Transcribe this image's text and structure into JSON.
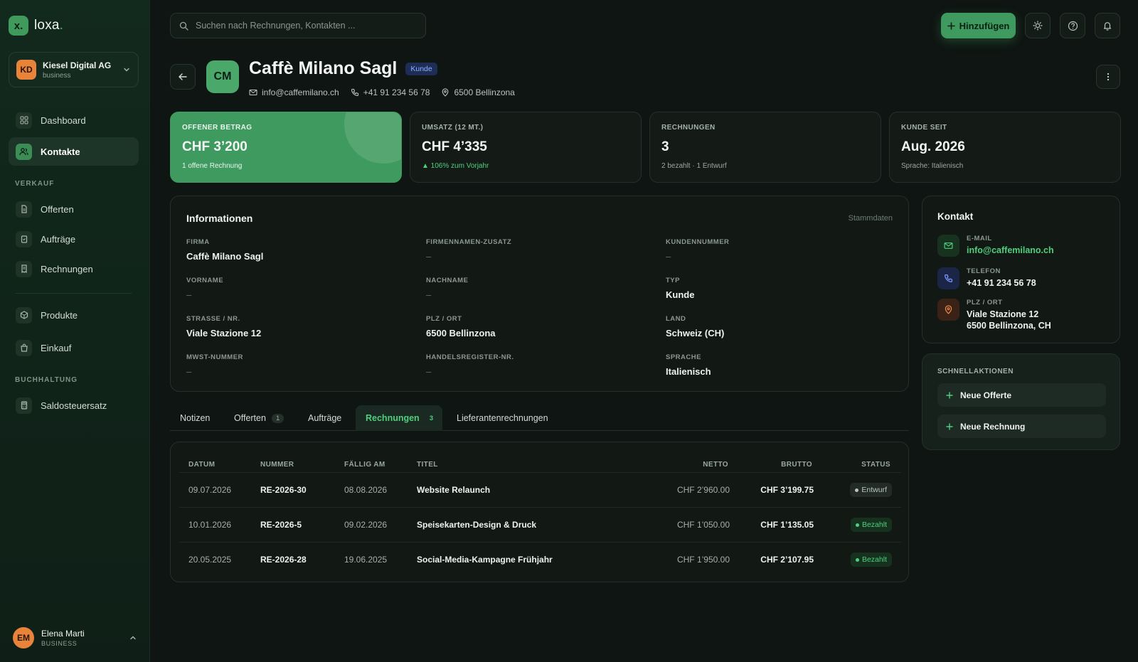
{
  "brand": {
    "logo": "x.",
    "name": "loxa",
    "dot": "."
  },
  "org": {
    "initials": "KD",
    "name": "Kiesel Digital AG",
    "plan": "business"
  },
  "nav": {
    "dashboard": "Dashboard",
    "kontakte": "Kontakte",
    "section_verkauf": "VERKAUF",
    "offerten": "Offerten",
    "auftraege": "Aufträge",
    "rechnungen": "Rechnungen",
    "produkte": "Produkte",
    "einkauf": "Einkauf",
    "section_buchhaltung": "BUCHHALTUNG",
    "saldo": "Saldosteuersatz"
  },
  "user": {
    "initials": "EM",
    "name": "Elena Marti",
    "plan": "BUSINESS"
  },
  "topbar": {
    "search_placeholder": "Suchen nach Rechnungen, Kontakten ...",
    "add_label": "Hinzufügen"
  },
  "contact": {
    "initials": "CM",
    "name": "Caffè Milano Sagl",
    "badge": "Kunde",
    "email": "info@caffemilano.ch",
    "phone": "+41 91 234 56 78",
    "location": "6500 Bellinzona"
  },
  "stats": [
    {
      "label": "OFFENER BETRAG",
      "value": "CHF 3’200",
      "sub": "1 offene Rechnung"
    },
    {
      "label": "UMSATZ (12 MT.)",
      "value": "CHF 4’335",
      "sub": "▲ 106% zum Vorjahr"
    },
    {
      "label": "RECHNUNGEN",
      "value": "3",
      "sub": "2 bezahlt · 1 Entwurf"
    },
    {
      "label": "KUNDE SEIT",
      "value": "Aug. 2026",
      "sub": "Sprache: Italienisch"
    }
  ],
  "info": {
    "title": "Informationen",
    "right_label": "Stammdaten",
    "fields": [
      {
        "label": "FIRMA",
        "value": "Caffè Milano Sagl"
      },
      {
        "label": "FIRMENNAMEN-ZUSATZ",
        "value": "–"
      },
      {
        "label": "KUNDENNUMMER",
        "value": "–"
      },
      {
        "label": "VORNAME",
        "value": "–"
      },
      {
        "label": "NACHNAME",
        "value": "–"
      },
      {
        "label": "TYP",
        "value": "Kunde"
      },
      {
        "label": "STRASSE / NR.",
        "value": "Viale Stazione 12"
      },
      {
        "label": "PLZ / ORT",
        "value": "6500 Bellinzona"
      },
      {
        "label": "LAND",
        "value": "Schweiz (CH)"
      },
      {
        "label": "MWST-NUMMER",
        "value": "–"
      },
      {
        "label": "HANDELSREGISTER-NR.",
        "value": "–"
      },
      {
        "label": "SPRACHE",
        "value": "Italienisch"
      }
    ]
  },
  "kontakt": {
    "title": "Kontakt",
    "email_label": "E-MAIL",
    "email": "info@caffemilano.ch",
    "phone_label": "TELEFON",
    "phone": "+41 91 234 56 78",
    "addr_label": "PLZ / ORT",
    "addr_line1": "Viale Stazione 12",
    "addr_line2": "6500 Bellinzona, CH"
  },
  "quick": {
    "title": "SCHNELLAKTIONEN",
    "new_offer": "Neue Offerte",
    "new_invoice": "Neue Rechnung"
  },
  "tabs": [
    {
      "label": "Notizen",
      "count": ""
    },
    {
      "label": "Offerten",
      "count": "1"
    },
    {
      "label": "Aufträge",
      "count": ""
    },
    {
      "label": "Rechnungen",
      "count": "3"
    },
    {
      "label": "Lieferantenrechnungen",
      "count": ""
    }
  ],
  "table": {
    "headers": {
      "datum": "DATUM",
      "nummer": "NUMMER",
      "faellig": "FÄLLIG AM",
      "titel": "TITEL",
      "netto": "NETTO",
      "brutto": "BRUTTO",
      "status": "STATUS"
    },
    "rows": [
      {
        "datum": "09.07.2026",
        "nummer": "RE-2026-30",
        "faellig": "08.08.2026",
        "titel": "Website Relaunch",
        "netto": "CHF 2’960.00",
        "brutto": "CHF 3’199.75",
        "status": "Entwurf"
      },
      {
        "datum": "10.01.2026",
        "nummer": "RE-2026-5",
        "faellig": "09.02.2026",
        "titel": "Speisekarten-Design & Druck",
        "netto": "CHF 1’050.00",
        "brutto": "CHF 1’135.05",
        "status": "Bezahlt"
      },
      {
        "datum": "20.05.2025",
        "nummer": "RE-2026-28",
        "faellig": "19.06.2025",
        "titel": "Social-Media-Kampagne Frühjahr",
        "netto": "CHF 1’950.00",
        "brutto": "CHF 2’107.95",
        "status": "Bezahlt"
      }
    ]
  },
  "colors": {
    "accent": "#3e9a5e",
    "accent_text": "#4fcf7c",
    "background": "#0f1512",
    "sidebar": "#12291d"
  }
}
